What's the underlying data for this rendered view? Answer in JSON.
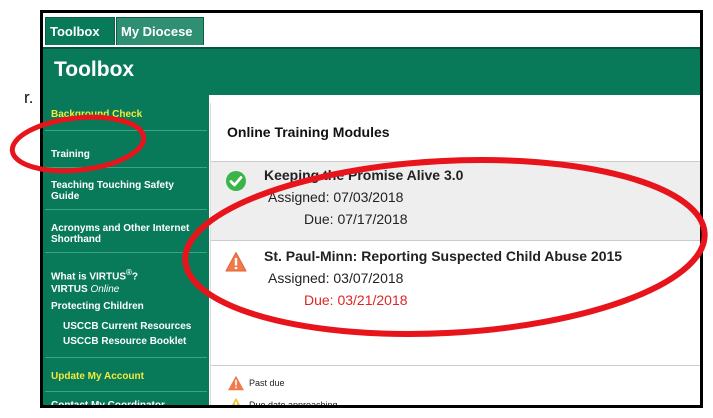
{
  "outside_text": "r.",
  "tabs": [
    {
      "label": "Toolbox",
      "active": true
    },
    {
      "label": "My Diocese",
      "active": false
    }
  ],
  "header": {
    "title": "Toolbox"
  },
  "sidebar": {
    "items": [
      {
        "label": "Background Check",
        "color": "yellow"
      },
      {
        "label": "Training",
        "color": "white"
      },
      {
        "label": "Teaching Touching Safety Guide",
        "color": "white"
      },
      {
        "label": "Acronyms and Other Internet Shorthand",
        "color": "white"
      },
      {
        "label_main": "What is VIRTUS",
        "label_sup": "®",
        "label_tail": "?",
        "color": "white"
      },
      {
        "label_main": "VIRTUS ",
        "label_em": "Online",
        "color": "white"
      },
      {
        "label": "Protecting Children",
        "color": "white"
      },
      {
        "label": "USCCB Current Resources",
        "color": "white",
        "sub": true
      },
      {
        "label": "USCCB Resource Booklet",
        "color": "white",
        "sub": true
      },
      {
        "label": "Update My Account",
        "color": "yellow"
      },
      {
        "label": "Contact My Coordinator",
        "color": "white"
      }
    ]
  },
  "main": {
    "title": "Online Training Modules",
    "modules": [
      {
        "name": "Keeping the Promise Alive 3.0",
        "assigned": "Assigned: 07/03/2018",
        "due": "Due: 07/17/2018",
        "status": "complete",
        "icon": "check-circle-icon"
      },
      {
        "name": "St. Paul-Minn: Reporting Suspected Child Abuse 2015",
        "assigned": "Assigned: 03/07/2018",
        "due": "Due: 03/21/2018",
        "status": "past-due",
        "icon": "warning-triangle-icon"
      }
    ],
    "legend": [
      {
        "label": "Past due",
        "icon": "warning-triangle-red-icon"
      },
      {
        "label": "Due date approaching",
        "icon": "warning-triangle-yellow-icon"
      }
    ]
  },
  "colors": {
    "brand_green": "#087a5a",
    "sidebar_highlight": "#f2ea3c",
    "past_due_red": "#e02424",
    "annotation_red": "#e8141b",
    "check_green": "#3bb54a",
    "warning_orange": "#f07b4a"
  }
}
